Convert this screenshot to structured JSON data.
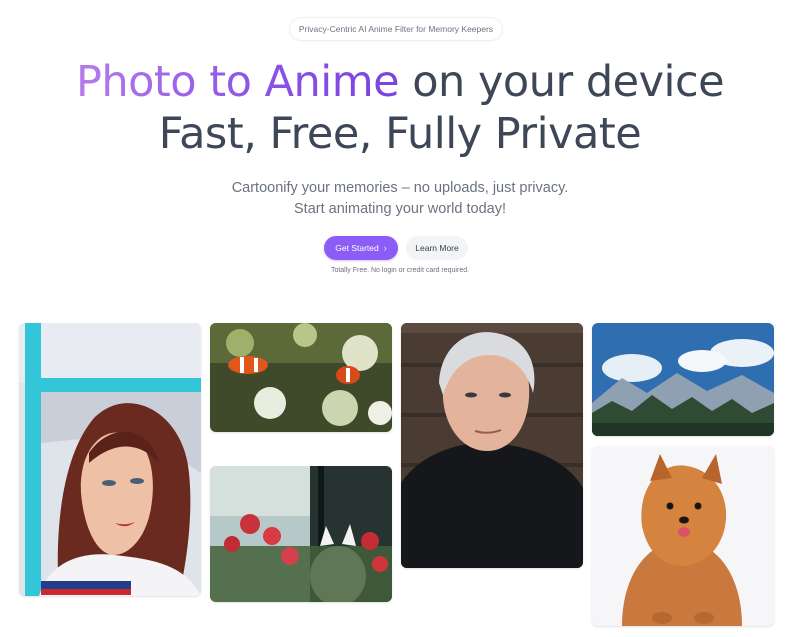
{
  "hero": {
    "badge": "Privacy-Centric AI Anime Filter for Memory Keepers",
    "headline_accent": "Photo to Anime",
    "headline_rest": " on your device",
    "headline_line2": "Fast, Free, Fully Private",
    "subtitle_line1": "Cartoonify your memories – no uploads, just privacy.",
    "subtitle_line2": "Start animating your world today!",
    "primary_button": "Get Started",
    "secondary_button": "Learn More",
    "note": "Totally Free. No login or credit card required.",
    "accent_color": "#8b5cf6"
  },
  "icons": {
    "primary_button_icon": "chevron-right-icon"
  },
  "gallery": {
    "images": [
      "anime-portrait-woman",
      "anime-clownfish-reef",
      "anime-portrait-man",
      "anime-mountain-landscape",
      "anime-flowers-cat-window",
      "anime-pomeranian-dog"
    ]
  }
}
